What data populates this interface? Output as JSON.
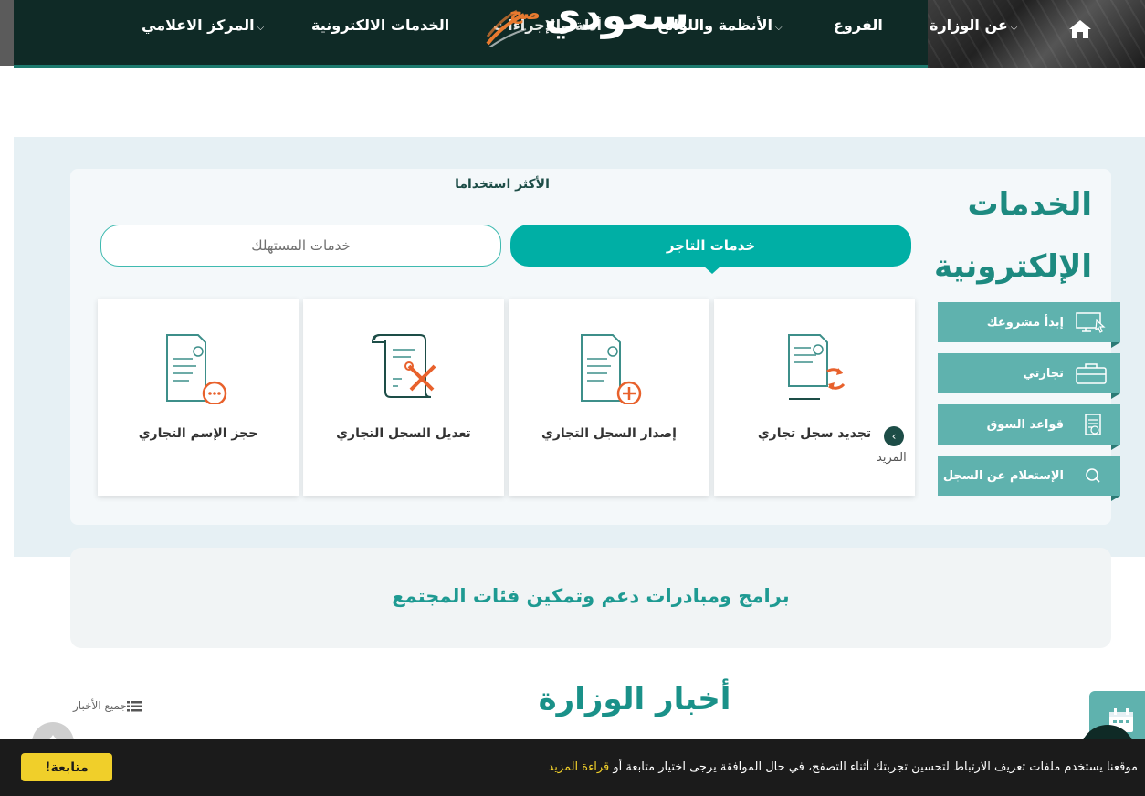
{
  "nav": {
    "items": [
      {
        "label": "عن الوزارة",
        "dropdown": true
      },
      {
        "label": "الأنظمة واللوائح",
        "dropdown": true
      },
      {
        "label": "الفروع",
        "dropdown": false
      },
      {
        "label": "الخدمات الالكترونية",
        "dropdown": false
      },
      {
        "label": "المركز الاعلامي",
        "dropdown": true
      }
    ],
    "logo": {
      "text": "سعودي",
      "accent": "صح",
      "overlay": "أدلة والإجراءات"
    },
    "colors": {
      "dark": "#0f2a26",
      "accent": "#1d7a6e"
    }
  },
  "services": {
    "title_line1": "الخدمات",
    "title_line2": "الإلكترونية",
    "most_used": "الأكثر استخداما",
    "tabs": {
      "merchant": "خدمات التاجر",
      "consumer": "خدمات المستهلك"
    },
    "side_buttons": [
      {
        "label": "إبدأ مشروعك",
        "icon": "monitor-cursor-icon"
      },
      {
        "label": "تجارتي",
        "icon": "briefcase-icon"
      },
      {
        "label": "قواعد السوق",
        "icon": "rules-document-icon"
      },
      {
        "label": "الإستعلام عن السجل",
        "icon": "search-icon"
      }
    ],
    "cards": [
      {
        "label": "تجديد سجل تجاري",
        "icon": "renew-document-icon"
      },
      {
        "label": "إصدار السجل التجاري",
        "icon": "add-document-icon"
      },
      {
        "label": "تعديل السجل التجاري",
        "icon": "edit-scroll-icon"
      },
      {
        "label": "حجز الإسم التجاري",
        "icon": "reserve-document-icon"
      }
    ],
    "more": "المزيد",
    "colors": {
      "teal": "#00afa5",
      "side": "#5fb2ae",
      "title": "#1d8a80"
    }
  },
  "community": {
    "title": "برامج ومبادرات دعم وتمكين فئات المجتمع"
  },
  "news": {
    "title": "أخبار الوزارة",
    "all_news": "جميع الأخبار"
  },
  "cookie": {
    "text": "موقعنا يستخدم ملفات تعريف الارتباط لتحسين تجربتك أثناء التصفح، في حال الموافقة يرجى اختيار متابعة أو",
    "more": "قراءة المزيد",
    "accept": "متابعة!"
  }
}
